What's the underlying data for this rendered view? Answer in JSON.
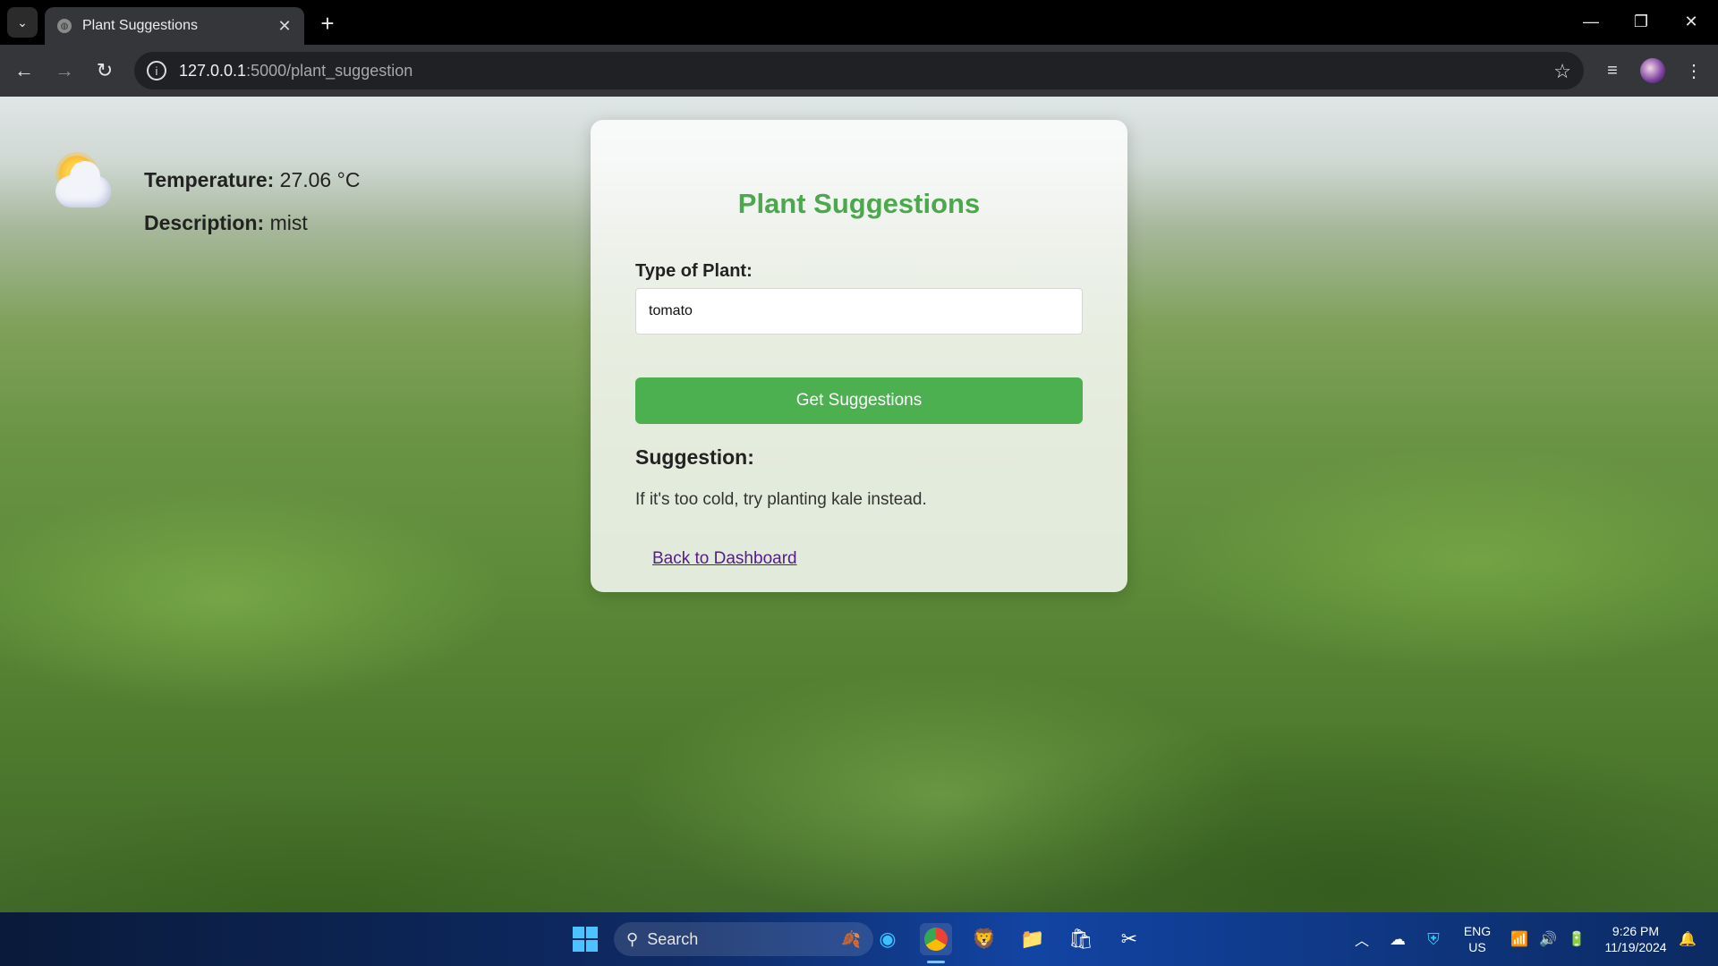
{
  "browser": {
    "tab_title": "Plant Suggestions",
    "tab_close": "✕",
    "new_tab": "+",
    "url_host": "127.0.0.1",
    "url_path": ":5000/plant_suggestion",
    "window_controls": {
      "minimize": "—",
      "restore": "❐",
      "close": "✕"
    }
  },
  "weather": {
    "temperature_label": "Temperature:",
    "temperature_value": "27.06 °C",
    "description_label": "Description:",
    "description_value": "mist"
  },
  "form": {
    "title": "Plant Suggestions",
    "plant_label": "Type of Plant:",
    "plant_value": "tomato",
    "submit_label": "Get Suggestions",
    "suggestion_heading": "Suggestion:",
    "suggestion_text": "If it's too cold, try planting kale instead.",
    "back_link": "Back to Dashboard"
  },
  "taskbar": {
    "search_placeholder": "Search",
    "lang_top": "ENG",
    "lang_bottom": "US",
    "time": "9:26 PM",
    "date": "11/19/2024"
  },
  "colors": {
    "accent_green": "#4caf50",
    "title_green": "#4ba84d",
    "link_visited": "#551a8b"
  }
}
